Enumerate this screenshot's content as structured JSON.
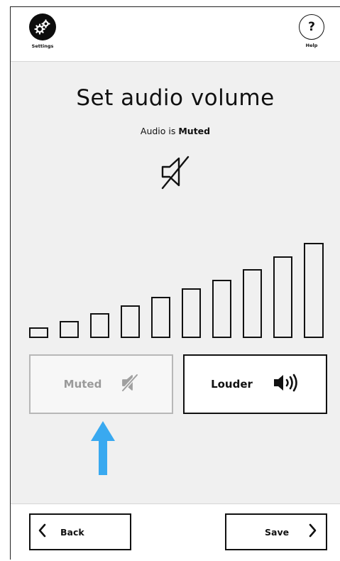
{
  "topbar": {
    "settings_label": "Settings",
    "help_glyph": "?",
    "help_label": "Help",
    "settings_icon": "gears-icon"
  },
  "main": {
    "title": "Set audio volume",
    "status_prefix": "Audio is ",
    "status_value": "Muted",
    "status_icon": "speaker-muted-icon"
  },
  "volume": {
    "levels": 10,
    "current_level": 0
  },
  "buttons": {
    "muted_label": "Muted",
    "muted_icon": "speaker-muted-icon",
    "louder_label": "Louder",
    "louder_icon": "speaker-loud-icon"
  },
  "hint": {
    "icon": "up-arrow-icon",
    "color": "#39a9f0"
  },
  "nav": {
    "back_label": "Back",
    "save_label": "Save"
  }
}
